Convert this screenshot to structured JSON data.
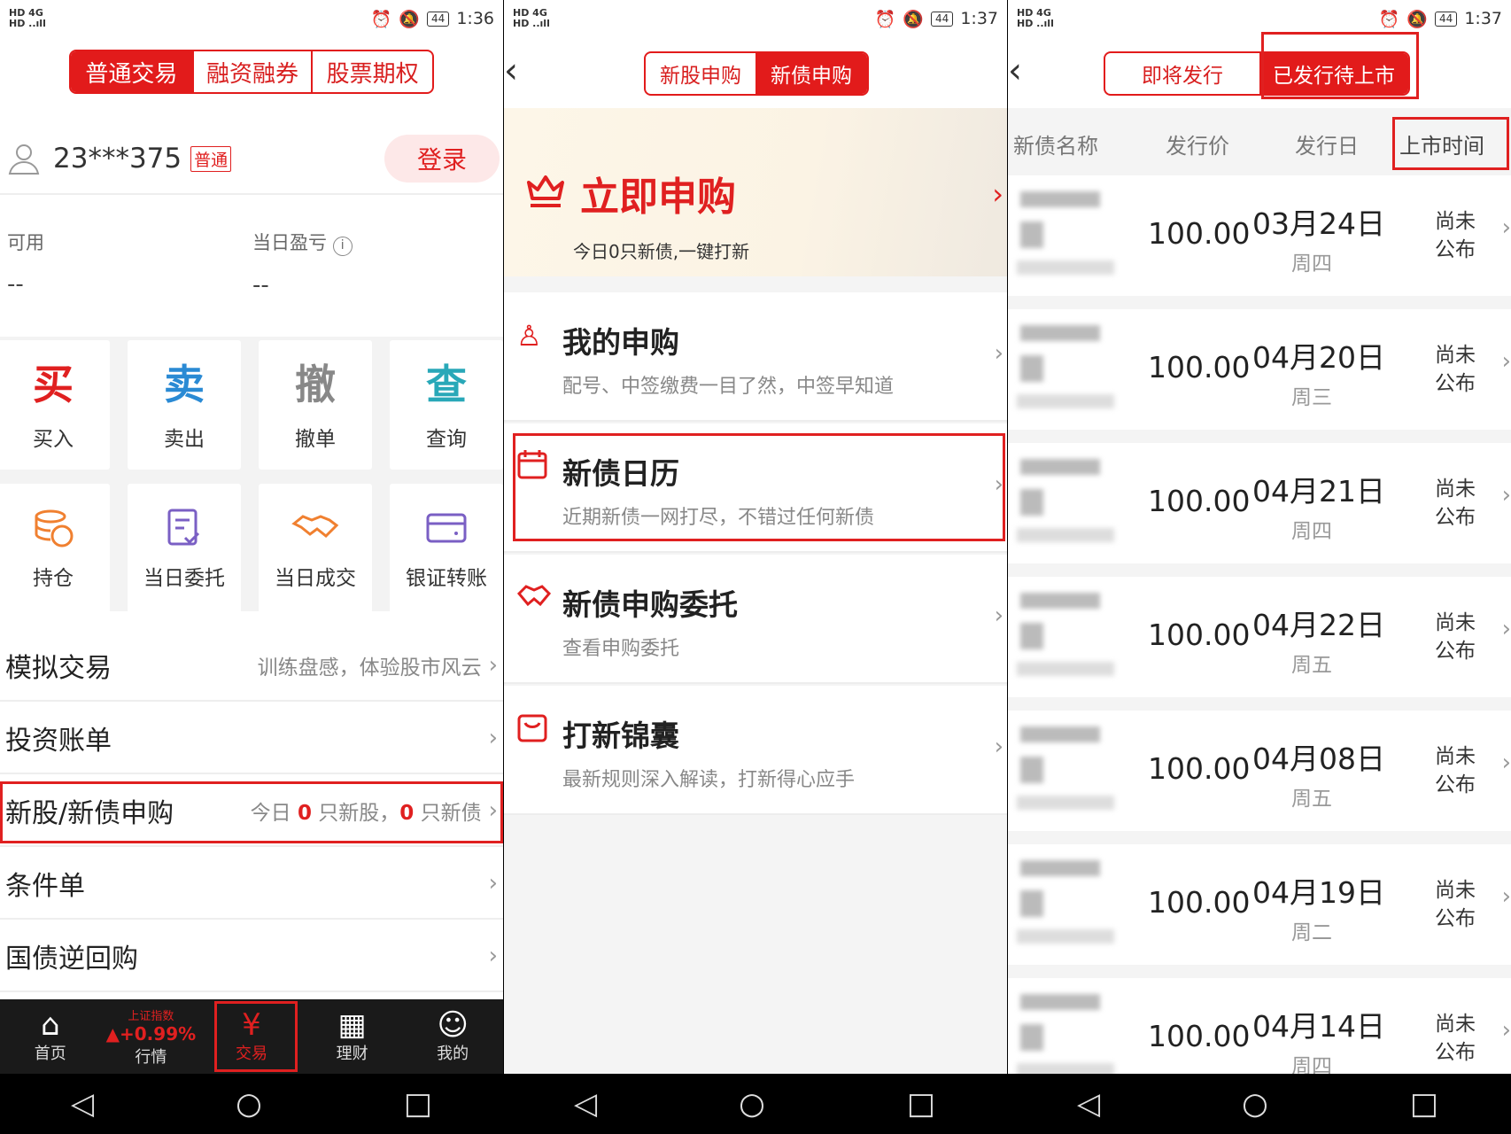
{
  "status": {
    "p1_time": "1:36",
    "p2_time": "1:37",
    "p3_time": "1:37",
    "battery": "44",
    "signal": "HD 4G"
  },
  "p1": {
    "tabs": [
      "普通交易",
      "融资融券",
      "股票期权"
    ],
    "account": "23***375",
    "account_tag": "普通",
    "login": "登录",
    "available_label": "可用",
    "available_value": "--",
    "pnl_label": "当日盈亏",
    "pnl_value": "--",
    "actions": [
      {
        "glyph": "买",
        "label": "买入",
        "color": "#e02020"
      },
      {
        "glyph": "卖",
        "label": "卖出",
        "color": "#2a8ad4"
      },
      {
        "glyph": "撤",
        "label": "撤单",
        "color": "#888888"
      },
      {
        "glyph": "查",
        "label": "查询",
        "color": "#29a8b8"
      }
    ],
    "actions2": [
      {
        "label": "持仓",
        "color": "#f08030"
      },
      {
        "label": "当日委托",
        "color": "#7a5fc4"
      },
      {
        "label": "当日成交",
        "color": "#f08030"
      },
      {
        "label": "银证转账",
        "color": "#7a5fc4"
      }
    ],
    "rows": [
      {
        "title": "模拟交易",
        "sub": "训练盘感，体验股市风云"
      },
      {
        "title": "投资账单",
        "sub": ""
      },
      {
        "title": "新股/新债申购",
        "sub_a": "今日 ",
        "n1": "0",
        "sub_b": " 只新股，",
        "n2": "0",
        "sub_c": " 只新债"
      },
      {
        "title": "条件单",
        "sub": ""
      },
      {
        "title": "国债逆回购",
        "sub": ""
      }
    ],
    "tabbar": [
      {
        "label": "首页",
        "icon": "⌂"
      },
      {
        "label": "行情",
        "top": "上证指数",
        "change": "▲+0.99%"
      },
      {
        "label": "交易",
        "icon": "¥"
      },
      {
        "label": "理财",
        "icon": "▦"
      },
      {
        "label": "我的",
        "icon": "☺"
      }
    ]
  },
  "p2": {
    "tabs": [
      "新股申购",
      "新债申购"
    ],
    "banner_title": "立即申购",
    "banner_sub": "今日0只新债,一键打新",
    "menus": [
      {
        "title": "我的申购",
        "sub": "配号、中签缴费一目了然，中签早知道",
        "icon": "person-icon"
      },
      {
        "title": "新债日历",
        "sub": "近期新债一网打尽，不错过任何新债",
        "icon": "calendar-icon"
      },
      {
        "title": "新债申购委托",
        "sub": "查看申购委托",
        "icon": "handshake-icon"
      },
      {
        "title": "打新锦囊",
        "sub": "最新规则深入解读，打新得心应手",
        "icon": "bag-icon"
      }
    ]
  },
  "p3": {
    "tabs": [
      "即将发行",
      "已发行待上市"
    ],
    "headers": [
      "新债名称",
      "发行价",
      "发行日",
      "上市时间"
    ],
    "rows": [
      {
        "price": "100.00",
        "date": "03月24日",
        "week": "周四",
        "listing": "尚未公布"
      },
      {
        "price": "100.00",
        "date": "04月20日",
        "week": "周三",
        "listing": "尚未公布"
      },
      {
        "price": "100.00",
        "date": "04月21日",
        "week": "周四",
        "listing": "尚未公布"
      },
      {
        "price": "100.00",
        "date": "04月22日",
        "week": "周五",
        "listing": "尚未公布"
      },
      {
        "price": "100.00",
        "date": "04月08日",
        "week": "周五",
        "listing": "尚未公布"
      },
      {
        "price": "100.00",
        "date": "04月19日",
        "week": "周二",
        "listing": "尚未公布"
      },
      {
        "price": "100.00",
        "date": "04月14日",
        "week": "周四",
        "listing": "尚未公布"
      }
    ]
  },
  "navbar": [
    "◁",
    "○",
    "□"
  ]
}
